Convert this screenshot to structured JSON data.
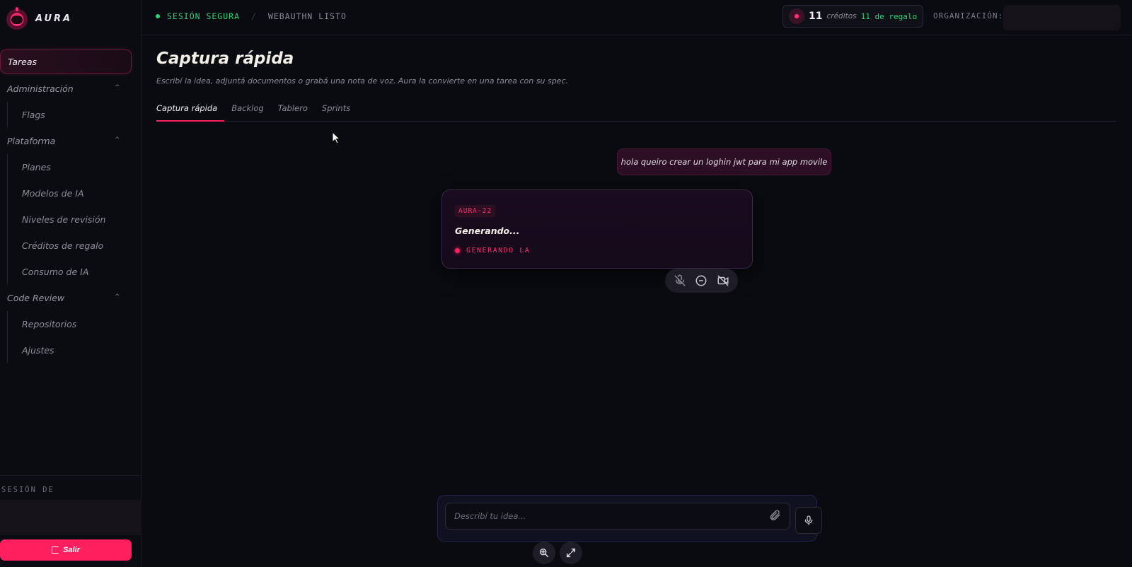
{
  "brand": {
    "name": "AURA"
  },
  "topbar": {
    "status_secure": "SESIÓN SEGURA",
    "status_sep": "/",
    "status_webauthn": "WEBAUTHN LISTO",
    "credits": {
      "value": "11",
      "label": "créditos",
      "gift": "11 de regalo"
    },
    "org_label": "ORGANIZACIÓN:"
  },
  "sidebar": {
    "items": [
      {
        "label": "Tareas",
        "active": true
      },
      {
        "label": "Administración",
        "group": true,
        "children": [
          {
            "label": "Flags"
          }
        ]
      },
      {
        "label": "Plataforma",
        "group": true,
        "children": [
          {
            "label": "Planes"
          },
          {
            "label": "Modelos de IA"
          },
          {
            "label": "Niveles de revisión"
          },
          {
            "label": "Créditos de regalo"
          },
          {
            "label": "Consumo de IA"
          }
        ]
      },
      {
        "label": "Code Review",
        "group": true,
        "children": [
          {
            "label": "Repositorios"
          },
          {
            "label": "Ajustes"
          }
        ]
      }
    ],
    "session_label": "SESIÓN DE",
    "logout_label": "Salir"
  },
  "main": {
    "title": "Captura rápida",
    "subtitle": "Escribí la idea, adjuntá documentos o grabá una nota de voz. Aura la convierte en una tarea con su spec.",
    "tabs": [
      {
        "label": "Captura rápida",
        "active": true
      },
      {
        "label": "Backlog"
      },
      {
        "label": "Tablero"
      },
      {
        "label": "Sprints"
      }
    ],
    "user_message": "hola queiro crear un loghin jwt para mi app movile",
    "task": {
      "badge": "AURA-22",
      "title": "Generando...",
      "status": "GENERANDO LA"
    },
    "composer": {
      "placeholder": "Describí tu idea..."
    }
  },
  "colors": {
    "accent": "#ff1f5f",
    "ok": "#2bd47a",
    "bg": "#0a0b10"
  }
}
